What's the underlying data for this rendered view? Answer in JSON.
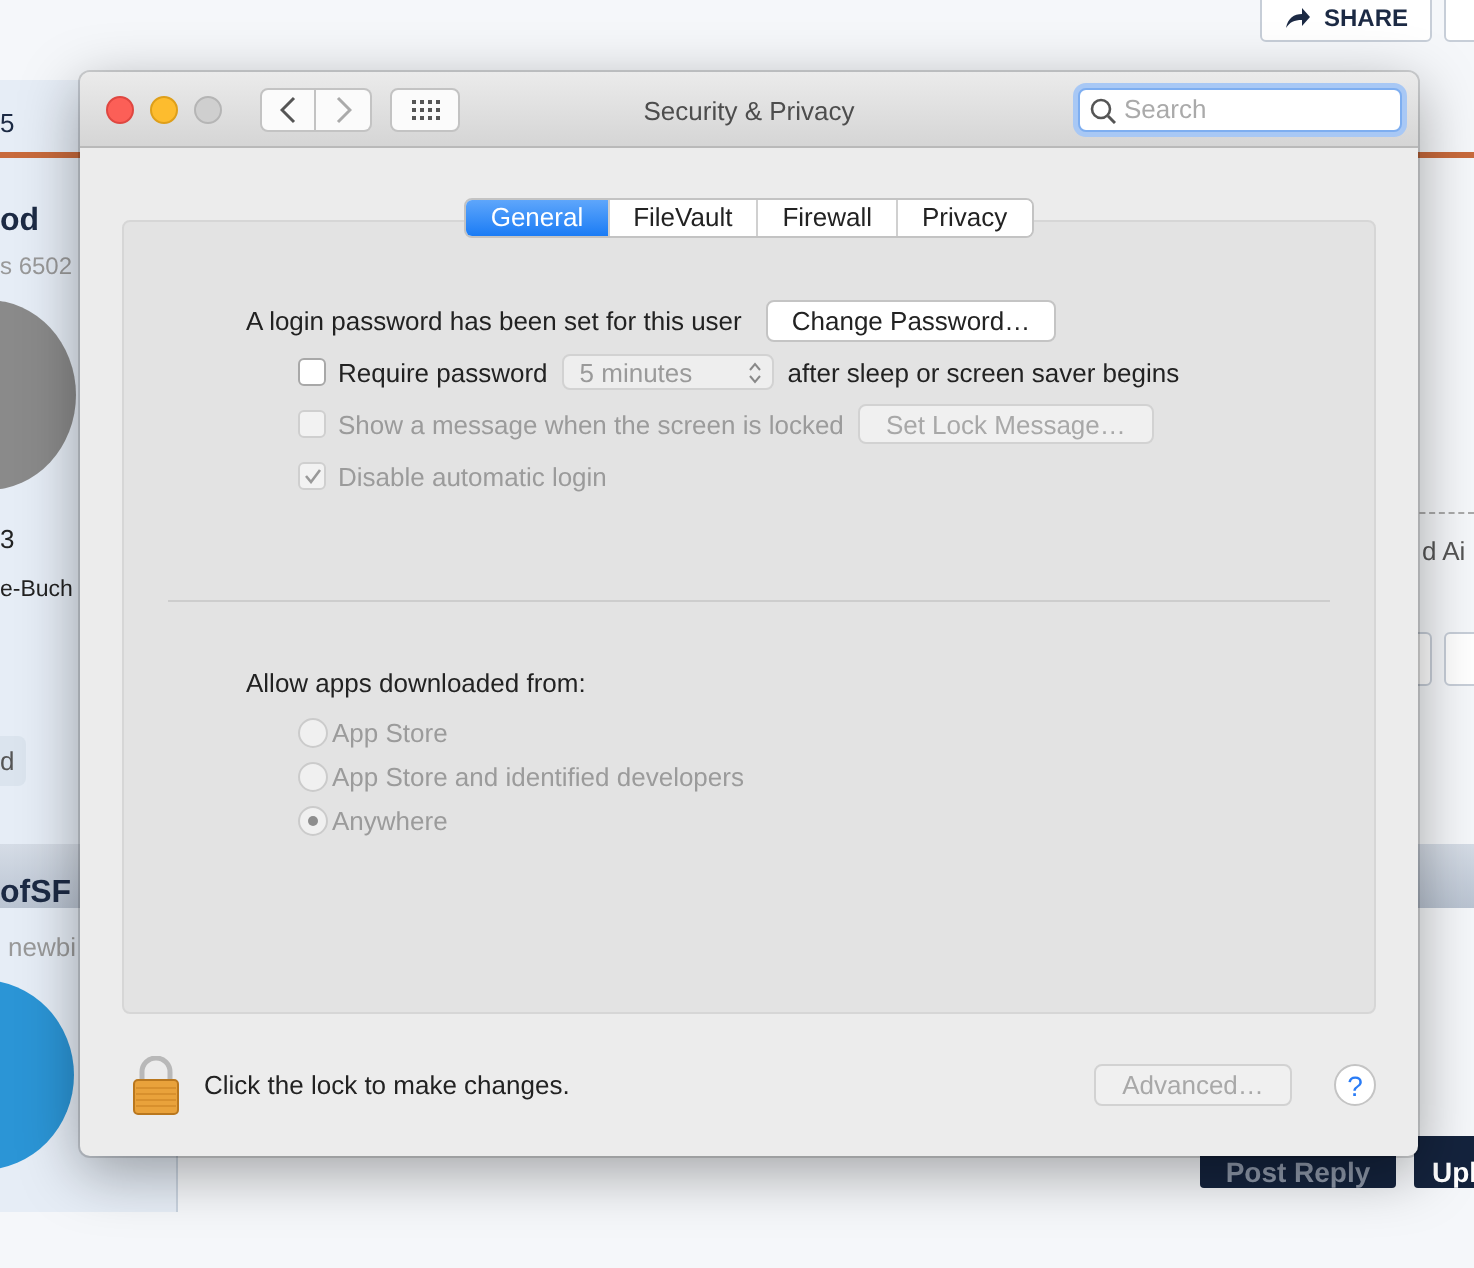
{
  "page_behind": {
    "share_button": "SHARE",
    "tab_fragment": "5",
    "post_1": {
      "author": "od",
      "author_detail": "s 6502",
      "line_1": "3",
      "line_2": "e-Buch",
      "tag": "d"
    },
    "post_2": {
      "author": "ofSF",
      "author_detail": "newbi"
    },
    "text_fragment": "d Ai",
    "buttons": [
      "Post Reply",
      "Upl"
    ]
  },
  "window": {
    "title": "Security & Privacy",
    "search": {
      "placeholder": "Search"
    }
  },
  "tabs": [
    {
      "label": "General",
      "selected": true
    },
    {
      "label": "FileVault",
      "selected": false
    },
    {
      "label": "Firewall",
      "selected": false
    },
    {
      "label": "Privacy",
      "selected": false
    }
  ],
  "general": {
    "password_text": "A login password has been set for this user",
    "change_password_button": "Change Password…",
    "options": [
      {
        "kind": "popup",
        "label": "Require password",
        "checked": false,
        "disabled": false,
        "popup": "5 minutes",
        "suffix": "after sleep or screen saver begins"
      },
      {
        "kind": "button",
        "label": "Show a message when the screen is locked",
        "checked": false,
        "disabled": true,
        "button": "Set Lock Message…"
      },
      {
        "kind": "plain",
        "label": "Disable automatic login",
        "checked": true,
        "disabled": true
      }
    ]
  },
  "allow_apps": {
    "label": "Allow apps downloaded from:",
    "options": [
      {
        "label": "App Store",
        "selected": false,
        "disabled": true
      },
      {
        "label": "App Store and identified developers",
        "selected": false,
        "disabled": true
      },
      {
        "label": "Anywhere",
        "selected": true,
        "disabled": true
      }
    ]
  },
  "footer": {
    "lock_text": "Click the lock to make changes.",
    "advanced_button": {
      "label": "Advanced…",
      "disabled": true
    },
    "help_button": "?"
  }
}
